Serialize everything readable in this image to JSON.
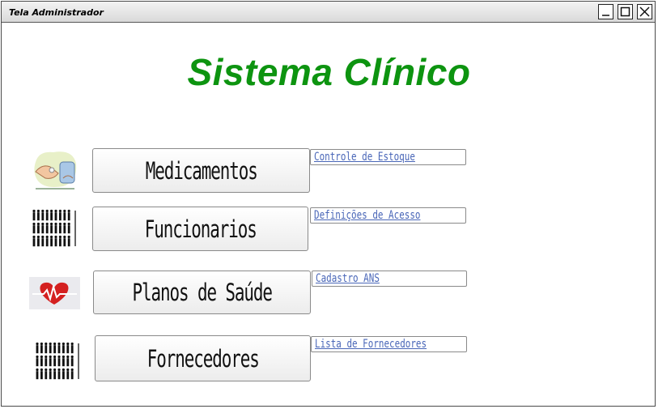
{
  "window": {
    "title": "Tela Administrador"
  },
  "header": {
    "title": "Sistema Clínico",
    "color": "#0d9410"
  },
  "rows": [
    {
      "button": "Medicamentos",
      "link": "Controle de Estoque",
      "icon": "medicine-icon"
    },
    {
      "button": "Funcionarios",
      "link": "Definições de Acesso",
      "icon": "people-icon"
    },
    {
      "button": "Planos de Saúde",
      "link": "Cadastro ANS",
      "icon": "heart-icon"
    },
    {
      "button": "Fornecedores",
      "link": "Lista de Fornecedores",
      "icon": "people-icon"
    }
  ],
  "colors": {
    "link": "#4a67b8",
    "heart": "#d42020"
  }
}
